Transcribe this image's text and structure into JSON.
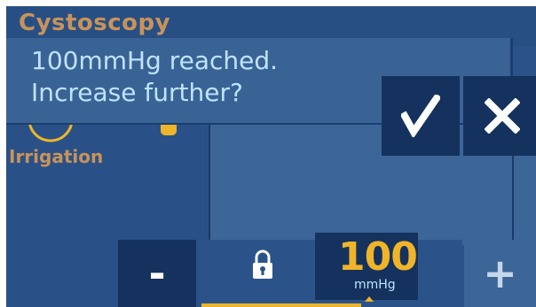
{
  "header": {
    "title": "Cystoscopy"
  },
  "panel": {
    "irrigation_label": "Irrigation"
  },
  "dialog": {
    "line1": "100mmHg reached.",
    "line2": "Increase further?",
    "confirm_icon": "checkmark-icon",
    "cancel_icon": "close-icon"
  },
  "pressure": {
    "minus_label": "-",
    "plus_label": "+",
    "value": "100",
    "unit": "mmHg",
    "lock_icon": "lock-icon"
  },
  "colors": {
    "background": "#2b5389",
    "dialog": "#3a6395",
    "button": "#14325d",
    "accent": "#f0b429",
    "text_light": "#bfe3ff",
    "label_orange": "#c8935a"
  }
}
